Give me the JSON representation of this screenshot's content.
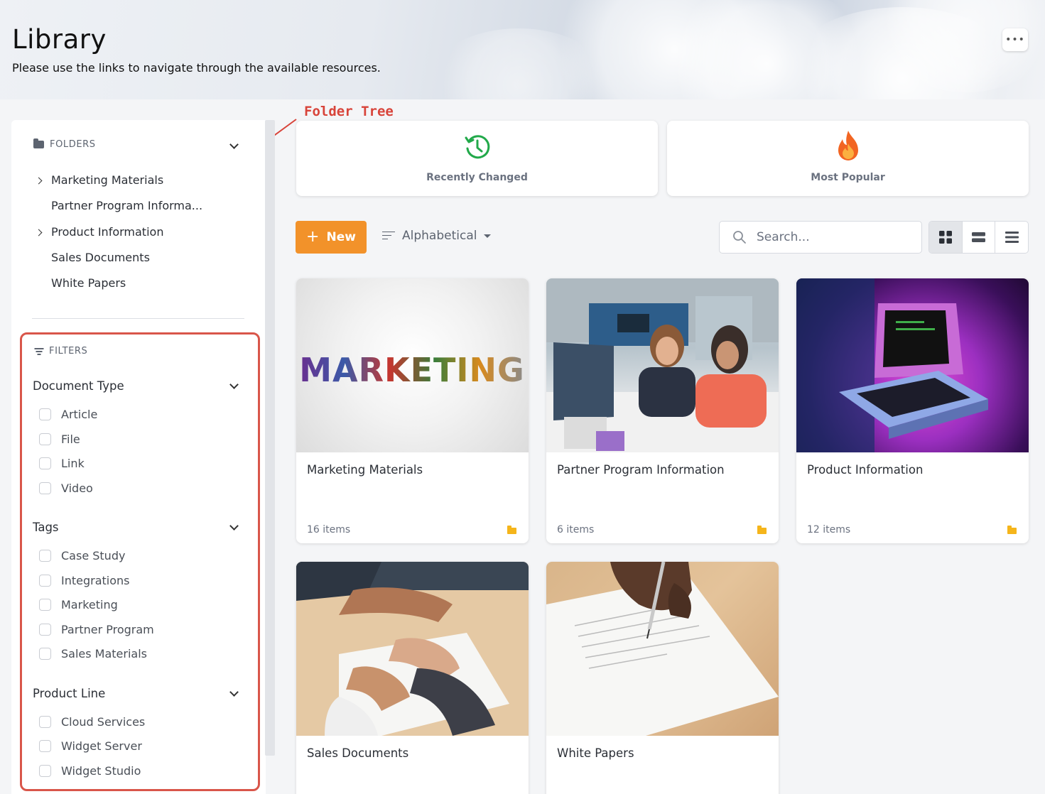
{
  "header": {
    "title": "Library",
    "subtitle": "Please use the links to navigate through the available resources.",
    "more_label": "•••"
  },
  "annotation": {
    "label": "Folder Tree",
    "color": "#d8443a"
  },
  "sidebar": {
    "folders_label": "FOLDERS",
    "folders": [
      {
        "label": "Marketing Materials",
        "expandable": true
      },
      {
        "label": "Partner Program Informa...",
        "expandable": false
      },
      {
        "label": "Product Information",
        "expandable": true
      },
      {
        "label": "Sales Documents",
        "expandable": false
      },
      {
        "label": "White Papers",
        "expandable": false
      }
    ],
    "filters_label": "FILTERS",
    "groups": [
      {
        "title": "Document Type",
        "options": [
          "Article",
          "File",
          "Link",
          "Video"
        ]
      },
      {
        "title": "Tags",
        "options": [
          "Case Study",
          "Integrations",
          "Marketing",
          "Partner Program",
          "Sales Materials"
        ]
      },
      {
        "title": "Product Line",
        "options": [
          "Cloud Services",
          "Widget Server",
          "Widget Studio"
        ]
      }
    ]
  },
  "quick_cards": [
    {
      "label": "Recently Changed",
      "icon": "clock-history-icon",
      "color": "#22a94a"
    },
    {
      "label": "Most Popular",
      "icon": "fire-icon",
      "color": "#f26522"
    }
  ],
  "toolbar": {
    "new_label": "New",
    "sort_label": "Alphabetical",
    "search_placeholder": "Search...",
    "accent": "#f2922a"
  },
  "cards": [
    {
      "title": "Marketing Materials",
      "count": "16 items",
      "image": "marketing-image"
    },
    {
      "title": "Partner Program Information",
      "count": "6 items",
      "image": "office-meeting-image"
    },
    {
      "title": "Product Information",
      "count": "12 items",
      "image": "retro-computer-image"
    },
    {
      "title": "Sales Documents",
      "count": "",
      "image": "contract-signing-image"
    },
    {
      "title": "White Papers",
      "count": "",
      "image": "pen-writing-image"
    }
  ]
}
